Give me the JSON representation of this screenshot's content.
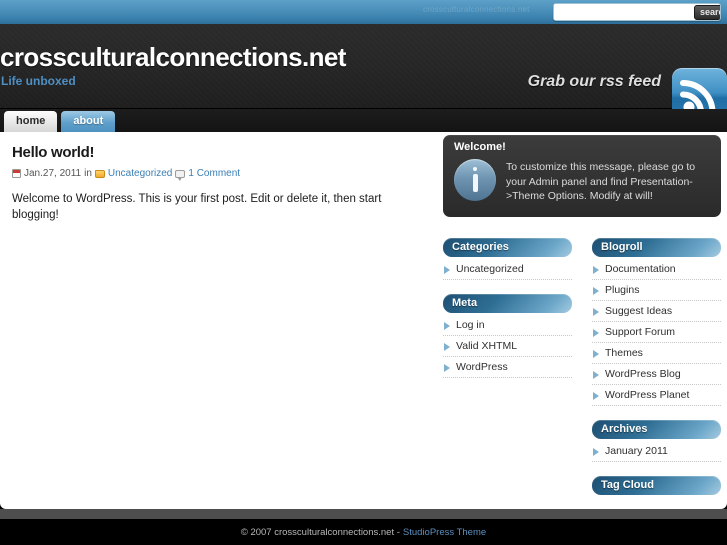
{
  "topbar": {
    "watermark": "crossculturalconnections.net",
    "search": {
      "value": "",
      "placeholder": "",
      "button_label": "search"
    }
  },
  "header": {
    "site_title": "crossculturalconnections.net",
    "tagline": "Life unboxed",
    "rss_text": "Grab our rss feed",
    "rss_icon": "rss-icon"
  },
  "nav": {
    "tabs": [
      {
        "label": "home",
        "state": "active"
      },
      {
        "label": "about",
        "state": "inactive"
      }
    ]
  },
  "post": {
    "title": "Hello world!",
    "meta": {
      "date_icon": "calendar-icon",
      "date": "Jan.27, 2011",
      "in_word": "in",
      "category_icon": "folder-icon",
      "category": "Uncategorized",
      "comment_icon": "comment-icon",
      "comments": "1 Comment"
    },
    "body": "Welcome to WordPress. This is your first post. Edit or delete it, then start blogging!"
  },
  "welcome": {
    "title": "Welcome!",
    "icon": "info-icon",
    "text": "To customize this message, please go to your Admin panel and find Presentation->Theme Options. Modify at will!"
  },
  "sidebar_left": [
    {
      "title": "Categories",
      "items": [
        "Uncategorized"
      ]
    },
    {
      "title": "Meta",
      "items": [
        "Log in",
        "Valid XHTML",
        "WordPress"
      ]
    }
  ],
  "sidebar_right": [
    {
      "title": "Blogroll",
      "items": [
        "Documentation",
        "Plugins",
        "Suggest Ideas",
        "Support Forum",
        "Themes",
        "WordPress Blog",
        "WordPress Planet"
      ]
    },
    {
      "title": "Archives",
      "items": [
        "January 2011"
      ]
    },
    {
      "title": "Tag Cloud",
      "items": []
    }
  ],
  "footer": {
    "copyright": "© 2007 crossculturalconnections.net -",
    "theme_link": "StudioPress Theme"
  },
  "colors": {
    "topbar_blue": "#4e93bd",
    "accent_link": "#3b7fb5",
    "tagline_blue": "#4e8fc4",
    "widget_head_dark": "#1d4f72",
    "widget_head_light": "#a6cbe0",
    "header_dark": "#262626",
    "footer_black": "#000000"
  }
}
